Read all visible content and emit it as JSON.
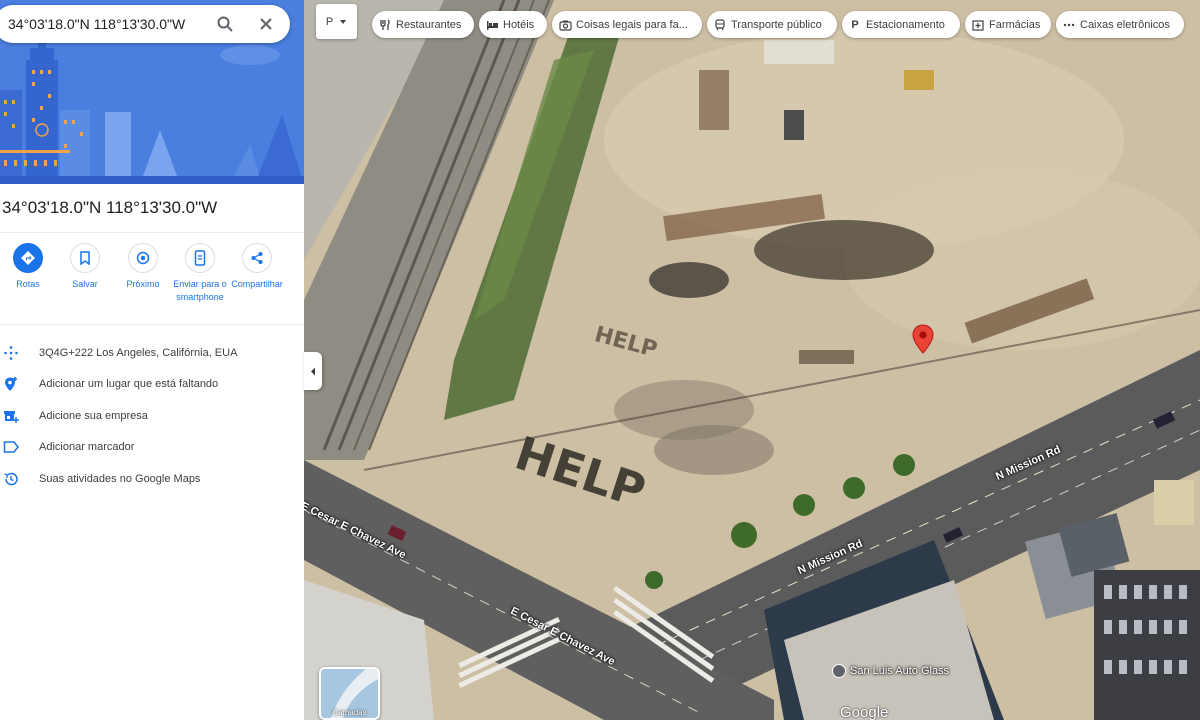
{
  "search": {
    "value": "34°03'18.0\"N 118°13'30.0\"W"
  },
  "place": {
    "title": "34°03'18.0\"N 118°13'30.0\"W"
  },
  "actions": [
    {
      "label": "Rotas",
      "icon": "directions-icon"
    },
    {
      "label": "Salvar",
      "icon": "bookmark-icon"
    },
    {
      "label": "Próximo",
      "icon": "nearby-icon"
    },
    {
      "label": "Enviar para o smartphone",
      "icon": "send-to-phone-icon"
    },
    {
      "label": "Compartilhar",
      "icon": "share-icon"
    }
  ],
  "info": [
    {
      "text": "3Q4G+222 Los Angeles, Califórnia, EUA",
      "icon": "plus-code-icon"
    },
    {
      "text": "Adicionar um lugar que está faltando",
      "icon": "add-location-icon"
    },
    {
      "text": "Adicione sua empresa",
      "icon": "add-business-icon"
    },
    {
      "text": "Adicionar marcador",
      "icon": "label-icon"
    },
    {
      "text": "Suas atividades no Google Maps",
      "icon": "history-icon"
    }
  ],
  "chips": [
    {
      "label": "Restaurantes",
      "icon": "restaurant-icon"
    },
    {
      "label": "Hotéis",
      "icon": "hotel-icon"
    },
    {
      "label": "Coisas legais para fa...",
      "icon": "camera-icon"
    },
    {
      "label": "Transporte público",
      "icon": "transit-icon"
    },
    {
      "label": "Estacionamento",
      "icon": "parking-icon"
    },
    {
      "label": "Farmácias",
      "icon": "pharmacy-icon"
    },
    {
      "label": "Caixas eletrônicos",
      "icon": "atm-icon"
    }
  ],
  "map": {
    "roads": {
      "cesar_chavez_top": "E Cesar E Chavez Ave",
      "cesar_chavez_bottom": "E Cesar E Chavez Ave",
      "mission_lower": "N Mission Rd",
      "mission_upper": "N Mission Rd"
    },
    "ground_text": [
      "HELP",
      "HELP"
    ],
    "poi": "San Luis Auto Glass",
    "imagery_toggle": "Camadas",
    "logo": "Google",
    "marker_color": "#ea4335"
  },
  "colors": {
    "accent": "#1a73e8",
    "hero": "#4a7fe0"
  }
}
